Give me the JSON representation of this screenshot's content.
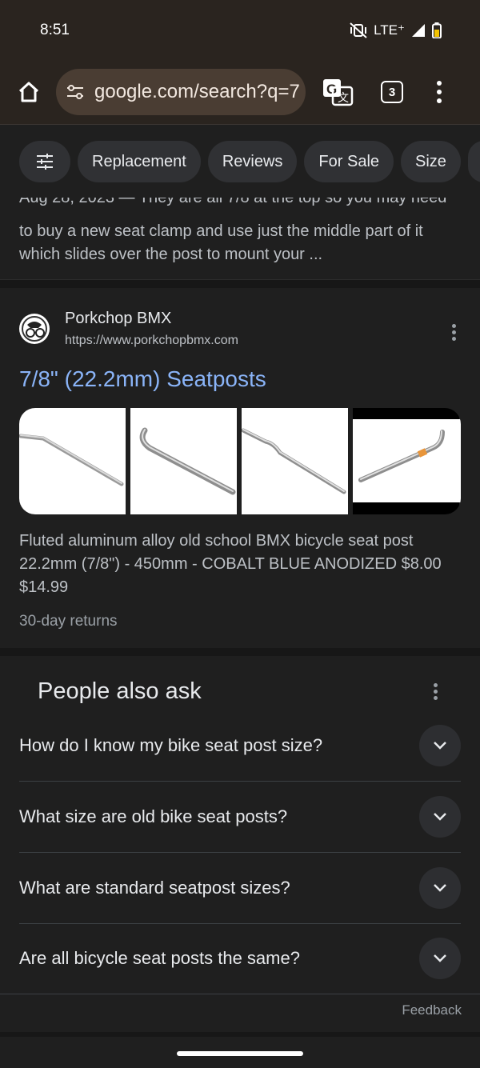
{
  "status_bar": {
    "time": "8:51",
    "network": "LTE⁺",
    "icons": [
      "mute-vibrate-icon",
      "signal-icon",
      "battery-icon"
    ]
  },
  "toolbar": {
    "url": "google.com/search?q=7",
    "tab_count": "3",
    "icons": [
      "home-icon",
      "site-info-icon",
      "translate-icon",
      "tab-switcher-icon",
      "overflow-menu-icon"
    ]
  },
  "chips": [
    "Replacement",
    "Reviews",
    "For Sale",
    "Size"
  ],
  "previous_snippet": {
    "cut_line": "Aug 28, 2023 — They are all 7/8 at the top so you may need",
    "text": "to buy a new seat clamp and use just the middle part of it which slides over the post to mount your ..."
  },
  "result": {
    "site_name": "Porkchop BMX",
    "site_url": "https://www.porkchopbmx.com",
    "title": "7/8\" (22.2mm) Seatposts",
    "description": "Fluted aluminum alloy old school BMX bicycle seat post 22.2mm (7/8\") - 450mm - COBALT BLUE ANODIZED $8.00 $14.99",
    "returns": "30-day returns"
  },
  "paa": {
    "title": "People also ask",
    "questions": [
      "How do I know my bike seat post size?",
      "What size are old bike seat posts?",
      "What are standard seatpost sizes?",
      "Are all bicycle seat posts the same?"
    ],
    "feedback": "Feedback"
  },
  "colors": {
    "background": "#1f1f1f",
    "toolbar": "#2a241f",
    "url_pill": "#4a3d33",
    "link": "#8ab4f8"
  }
}
